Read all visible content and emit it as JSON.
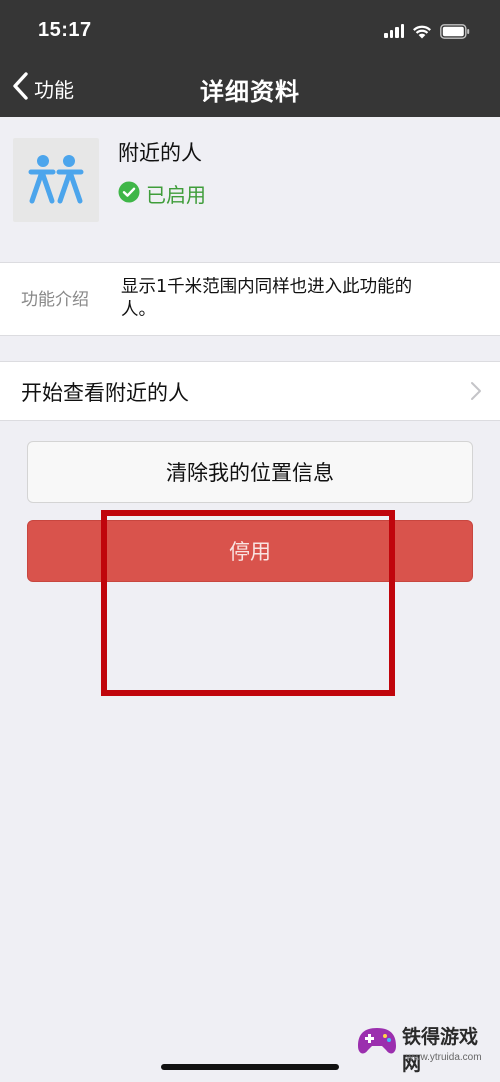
{
  "status_bar": {
    "time": "15:17",
    "icons": [
      "signal-icon",
      "wifi-icon",
      "battery-icon"
    ]
  },
  "nav": {
    "back_label": "功能",
    "title": "详细资料"
  },
  "profile": {
    "name": "附近的人",
    "status": "已启用",
    "status_color": "#3f9d3a",
    "icon": "people-nearby-icon",
    "icon_color": "#4ca5ec"
  },
  "intro": {
    "label": "功能介绍",
    "text": "显示1千米范围内同样也进入此功能的人。"
  },
  "action": {
    "label": "开始查看附近的人"
  },
  "buttons": {
    "clear_location": "清除我的位置信息",
    "disable": "停用"
  },
  "colors": {
    "nav_bg": "#363636",
    "page_bg": "#efeff4",
    "danger": "#d9534c",
    "annotation": "#c0050c"
  },
  "watermark": {
    "title": "铁得游戏网",
    "url": "www.ytruida.com"
  }
}
